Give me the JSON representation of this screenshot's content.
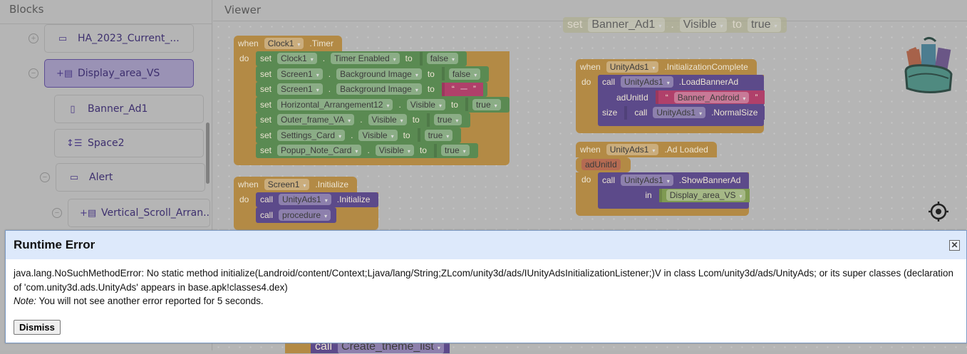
{
  "sidebar": {
    "title": "Blocks",
    "items": [
      {
        "label": "HA_2023_Current_...",
        "icon": "horizontal-arrangement-icon",
        "toggle": "+"
      },
      {
        "label": "Display_area_VS",
        "icon": "vertical-scroll-arrangement-icon",
        "toggle": "−",
        "selected": true
      },
      {
        "label": "Banner_Ad1",
        "icon": "banner-ad-icon"
      },
      {
        "label": "Space2",
        "icon": "space-icon"
      },
      {
        "label": "Alert",
        "icon": "notifier-icon",
        "toggle": "−"
      },
      {
        "label": "Vertical_Scroll_Arran...",
        "icon": "vertical-scroll-arrangement-icon",
        "toggle": "−"
      }
    ]
  },
  "viewer": {
    "title": "Viewer"
  },
  "colors": {
    "event": "#b38a45",
    "component_set": "#5a8a52",
    "method": "#5c4a8a",
    "text": "#b0406a",
    "logic": "#5a8a52",
    "component": "#7f9a52"
  },
  "blocks": [
    {
      "header": [
        {
          "k": "kw",
          "v": "when"
        },
        {
          "k": "dd",
          "v": "Clock1"
        },
        {
          "k": "kw",
          "v": ".Timer"
        }
      ],
      "rows": [
        {
          "c": "green",
          "t": [
            {
              "k": "kw",
              "v": "set"
            },
            {
              "k": "dd",
              "v": "Clock1"
            },
            {
              "k": "kw",
              "v": "."
            },
            {
              "k": "dd",
              "v": "Timer Enabled"
            },
            {
              "k": "kw",
              "v": "to"
            },
            {
              "k": "plug",
              "c": "logic",
              "t": [
                {
                  "k": "dd",
                  "v": "false"
                }
              ]
            }
          ]
        },
        {
          "c": "green",
          "t": [
            {
              "k": "kw",
              "v": "set"
            },
            {
              "k": "dd",
              "v": "Screen1"
            },
            {
              "k": "kw",
              "v": "."
            },
            {
              "k": "dd",
              "v": "Background Image"
            },
            {
              "k": "kw",
              "v": "to"
            },
            {
              "k": "plug",
              "c": "logic",
              "t": [
                {
                  "k": "dd",
                  "v": "false"
                }
              ]
            }
          ]
        },
        {
          "c": "green",
          "t": [
            {
              "k": "kw",
              "v": "set"
            },
            {
              "k": "dd",
              "v": "Screen1"
            },
            {
              "k": "kw",
              "v": "."
            },
            {
              "k": "dd",
              "v": "Background Image"
            },
            {
              "k": "kw",
              "v": "to"
            },
            {
              "k": "plug",
              "c": "text",
              "t": [
                {
                  "k": "kw",
                  "v": "“"
                },
                {
                  "k": "dd",
                  "v": " "
                },
                {
                  "k": "kw",
                  "v": "”"
                }
              ]
            }
          ]
        },
        {
          "c": "green",
          "t": [
            {
              "k": "kw",
              "v": "set"
            },
            {
              "k": "dd",
              "v": "Horizontal_Arrangement12"
            },
            {
              "k": "kw",
              "v": "."
            },
            {
              "k": "dd",
              "v": "Visible"
            },
            {
              "k": "kw",
              "v": "to"
            },
            {
              "k": "plug",
              "c": "logic",
              "t": [
                {
                  "k": "dd",
                  "v": "true"
                }
              ]
            }
          ]
        },
        {
          "c": "green",
          "t": [
            {
              "k": "kw",
              "v": "set"
            },
            {
              "k": "dd",
              "v": "Outer_frame_VA"
            },
            {
              "k": "kw",
              "v": "."
            },
            {
              "k": "dd",
              "v": "Visible"
            },
            {
              "k": "kw",
              "v": "to"
            },
            {
              "k": "plug",
              "c": "logic",
              "t": [
                {
                  "k": "dd",
                  "v": "true"
                }
              ]
            }
          ]
        },
        {
          "c": "green",
          "t": [
            {
              "k": "kw",
              "v": "set"
            },
            {
              "k": "dd",
              "v": "Settings_Card"
            },
            {
              "k": "kw",
              "v": "."
            },
            {
              "k": "dd",
              "v": "Visible"
            },
            {
              "k": "kw",
              "v": "to"
            },
            {
              "k": "plug",
              "c": "logic",
              "t": [
                {
                  "k": "dd",
                  "v": "true"
                }
              ]
            }
          ]
        },
        {
          "c": "green",
          "t": [
            {
              "k": "kw",
              "v": "set"
            },
            {
              "k": "dd",
              "v": "Popup_Note_Card"
            },
            {
              "k": "kw",
              "v": "."
            },
            {
              "k": "dd",
              "v": "Visible"
            },
            {
              "k": "kw",
              "v": "to"
            },
            {
              "k": "plug",
              "c": "logic",
              "t": [
                {
                  "k": "dd",
                  "v": "true"
                }
              ]
            }
          ]
        }
      ]
    },
    {
      "header": [
        {
          "k": "kw",
          "v": "when"
        },
        {
          "k": "dd",
          "v": "Screen1"
        },
        {
          "k": "kw",
          "v": ".Initialize"
        }
      ],
      "rows": [
        {
          "c": "purple",
          "t": [
            {
              "k": "kw",
              "v": "call"
            },
            {
              "k": "dd",
              "v": "UnityAds1"
            },
            {
              "k": "kw",
              "v": ".Initialize"
            }
          ]
        },
        {
          "c": "purple",
          "t": [
            {
              "k": "kw",
              "v": "call"
            },
            {
              "k": "dd",
              "v": "procedure"
            }
          ]
        }
      ]
    },
    {
      "header": [
        {
          "k": "kw",
          "v": "when"
        },
        {
          "k": "dd",
          "v": "UnityAds1"
        },
        {
          "k": "kw",
          "v": ".InitializationComplete"
        }
      ],
      "rows": [
        {
          "c": "purple",
          "t": [
            {
              "k": "kw",
              "v": "call"
            },
            {
              "k": "dd",
              "v": "UnityAds1"
            },
            {
              "k": "kw",
              "v": ".LoadBannerAd"
            }
          ],
          "args": [
            {
              "name": "adUnitId",
              "t": [
                {
                  "k": "plug",
                  "c": "text",
                  "t": [
                    {
                      "k": "kw",
                      "v": "“"
                    },
                    {
                      "k": "dd",
                      "v": "Banner_Android"
                    },
                    {
                      "k": "kw",
                      "v": "”"
                    }
                  ]
                }
              ]
            },
            {
              "name": "size",
              "t": [
                {
                  "k": "plug",
                  "c": "method",
                  "t": [
                    {
                      "k": "kw",
                      "v": "call"
                    },
                    {
                      "k": "dd",
                      "v": "UnityAds1"
                    },
                    {
                      "k": "kw",
                      "v": ".NormalSize"
                    }
                  ]
                }
              ]
            }
          ]
        }
      ]
    },
    {
      "header": [
        {
          "k": "kw",
          "v": "when"
        },
        {
          "k": "dd",
          "v": "UnityAds1"
        },
        {
          "k": "kw",
          "v": ".Ad Loaded"
        }
      ],
      "param": "adUnitId",
      "rows": [
        {
          "c": "purple",
          "t": [
            {
              "k": "kw",
              "v": "call"
            },
            {
              "k": "dd",
              "v": "UnityAds1"
            },
            {
              "k": "kw",
              "v": ".ShowBannerAd"
            }
          ],
          "args": [
            {
              "name": "in",
              "t": [
                {
                  "k": "plug",
                  "c": "component",
                  "t": [
                    {
                      "k": "dd",
                      "v": "Display_area_VS"
                    }
                  ]
                }
              ]
            }
          ]
        }
      ]
    }
  ],
  "partial_top": [
    {
      "k": "kw",
      "v": "set"
    },
    {
      "k": "dd",
      "v": "Banner_Ad1"
    },
    {
      "k": "kw",
      "v": "."
    },
    {
      "k": "dd",
      "v": "Visible"
    },
    {
      "k": "kw",
      "v": "to"
    },
    {
      "k": "dd",
      "v": "true"
    }
  ],
  "partial_bottom": [
    {
      "k": "kw",
      "v": "call"
    },
    {
      "k": "dd",
      "v": "Create_theme_list"
    }
  ],
  "do_label": "do",
  "dialog": {
    "title": "Runtime Error",
    "message": "java.lang.NoSuchMethodError: No static method initialize(Landroid/content/Context;Ljava/lang/String;ZLcom/unity3d/ads/IUnityAdsInitializationListener;)V in class Lcom/unity3d/ads/UnityAds; or its super classes (declaration of 'com.unity3d.ads.UnityAds' appears in base.apk!classes4.dex)",
    "note_label": "Note:",
    "note": " You will not see another error reported for 5 seconds.",
    "dismiss": "Dismiss",
    "close_icon": "close-icon"
  }
}
